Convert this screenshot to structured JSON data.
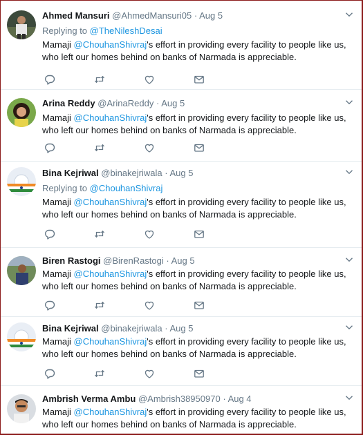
{
  "colors": {
    "link": "#1b95e0",
    "muted": "#657786",
    "text": "#14171a",
    "frame_border": "#8b1a1a"
  },
  "icons": {
    "reply": "reply-icon",
    "retweet": "retweet-icon",
    "like": "heart-icon",
    "dm": "envelope-icon",
    "menu": "chevron-down-icon"
  },
  "tweets": [
    {
      "name": "Ahmed Mansuri",
      "handle": "@AhmedMansuri05",
      "dot": "·",
      "date": "Aug 5",
      "replying_prefix": "Replying to ",
      "replying_to": "@TheNileshDesai",
      "text_before": "Mamaji ",
      "mention": "@ChouhanShivraj",
      "text_after": "'s effort in providing every facility to people like us, who left our homes behind on banks of Narmada is appreciable."
    },
    {
      "name": "Arina Reddy",
      "handle": "@ArinaReddy",
      "dot": "·",
      "date": "Aug 5",
      "text_before": "Mamaji ",
      "mention": "@ChouhanShivraj",
      "text_after": "'s effort in providing every facility to people like us, who left our homes behind on banks of Narmada is appreciable."
    },
    {
      "name": "Bina Kejriwal",
      "handle": "@binakejriwala",
      "dot": "·",
      "date": "Aug 5",
      "replying_prefix": "Replying to ",
      "replying_to": "@ChouhanShivraj",
      "text_before": "Mamaji ",
      "mention": "@ChouhanShivraj",
      "text_after": "'s effort in providing every facility to people like us, who left our homes behind on banks of Narmada is appreciable."
    },
    {
      "name": "Biren Rastogi",
      "handle": "@BirenRastogi",
      "dot": "·",
      "date": "Aug 5",
      "text_before": "Mamaji ",
      "mention": "@ChouhanShivraj",
      "text_after": "'s effort in providing every facility to people like us, who left our homes behind on banks of Narmada is appreciable."
    },
    {
      "name": "Bina Kejriwal",
      "handle": "@binakejriwala",
      "dot": "·",
      "date": "Aug 5",
      "text_before": "Mamaji ",
      "mention": "@ChouhanShivraj",
      "text_after": "'s effort in providing every facility to people like us, who left our homes behind on banks of Narmada is appreciable."
    },
    {
      "name": "Ambrish Verma Ambu",
      "handle": "@Ambrish38950970",
      "dot": "·",
      "date": "Aug 4",
      "text_before": "Mamaji ",
      "mention": "@ChouhanShivraj",
      "text_after": "'s effort in providing every facility to people like us, who left our homes behind on banks of Narmada is appreciable."
    }
  ]
}
